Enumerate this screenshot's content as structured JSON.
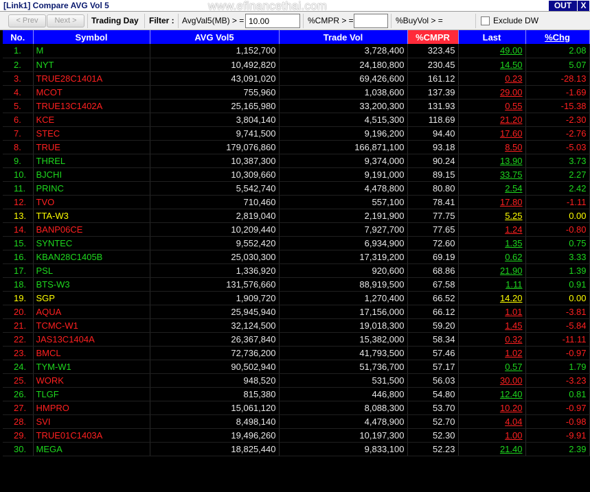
{
  "window": {
    "title": "[Link1] Compare AVG Vol 5",
    "watermark": "www.efinancethai.com",
    "out_label": "OUT",
    "close_label": "X"
  },
  "toolbar": {
    "prev_label": "< Prev",
    "next_label": "Next >",
    "trading_day_label": "Trading Day",
    "filter_label": "Filter :",
    "avgvol_label": "AvgVal5(MB) > =",
    "avgvol_value": "10.00",
    "cmpr_label": "%CMPR > =",
    "cmpr_value": "",
    "buyvol_label": "%BuyVol > =",
    "exclude_label": "Exclude DW"
  },
  "columns": [
    "No.",
    "Symbol",
    "AVG Vol5",
    "Trade Vol",
    "%CMPR",
    "Last",
    "%Chg"
  ],
  "colors": {
    "up": "#1ed81e",
    "down": "#ff2020",
    "unchanged": "#ffff00",
    "header": "#0000ff",
    "highlight_header": "#ff2a3a"
  },
  "rows": [
    {
      "no": "1.",
      "symbol": "M",
      "avg": "1,152,700",
      "trade": "3,728,400",
      "cmpr": "323.45",
      "last": "49.00",
      "chg": "2.08",
      "dir": "up"
    },
    {
      "no": "2.",
      "symbol": "NYT",
      "avg": "10,492,820",
      "trade": "24,180,800",
      "cmpr": "230.45",
      "last": "14.50",
      "chg": "5.07",
      "dir": "up"
    },
    {
      "no": "3.",
      "symbol": "TRUE28C1401A",
      "avg": "43,091,020",
      "trade": "69,426,600",
      "cmpr": "161.12",
      "last": "0.23",
      "chg": "-28.13",
      "dir": "down"
    },
    {
      "no": "4.",
      "symbol": "MCOT",
      "avg": "755,960",
      "trade": "1,038,600",
      "cmpr": "137.39",
      "last": "29.00",
      "chg": "-1.69",
      "dir": "down"
    },
    {
      "no": "5.",
      "symbol": "TRUE13C1402A",
      "avg": "25,165,980",
      "trade": "33,200,300",
      "cmpr": "131.93",
      "last": "0.55",
      "chg": "-15.38",
      "dir": "down"
    },
    {
      "no": "6.",
      "symbol": "KCE",
      "avg": "3,804,140",
      "trade": "4,515,300",
      "cmpr": "118.69",
      "last": "21.20",
      "chg": "-2.30",
      "dir": "down"
    },
    {
      "no": "7.",
      "symbol": "STEC",
      "avg": "9,741,500",
      "trade": "9,196,200",
      "cmpr": "94.40",
      "last": "17.60",
      "chg": "-2.76",
      "dir": "down"
    },
    {
      "no": "8.",
      "symbol": "TRUE",
      "avg": "179,076,860",
      "trade": "166,871,100",
      "cmpr": "93.18",
      "last": "8.50",
      "chg": "-5.03",
      "dir": "down"
    },
    {
      "no": "9.",
      "symbol": "THREL",
      "avg": "10,387,300",
      "trade": "9,374,000",
      "cmpr": "90.24",
      "last": "13.90",
      "chg": "3.73",
      "dir": "up"
    },
    {
      "no": "10.",
      "symbol": "BJCHI",
      "avg": "10,309,660",
      "trade": "9,191,000",
      "cmpr": "89.15",
      "last": "33.75",
      "chg": "2.27",
      "dir": "up"
    },
    {
      "no": "11.",
      "symbol": "PRINC",
      "avg": "5,542,740",
      "trade": "4,478,800",
      "cmpr": "80.80",
      "last": "2.54",
      "chg": "2.42",
      "dir": "up"
    },
    {
      "no": "12.",
      "symbol": "TVO",
      "avg": "710,460",
      "trade": "557,100",
      "cmpr": "78.41",
      "last": "17.80",
      "chg": "-1.11",
      "dir": "down"
    },
    {
      "no": "13.",
      "symbol": "TTA-W3",
      "avg": "2,819,040",
      "trade": "2,191,900",
      "cmpr": "77.75",
      "last": "5.25",
      "chg": "0.00",
      "dir": "eq"
    },
    {
      "no": "14.",
      "symbol": "BANP06CE",
      "avg": "10,209,440",
      "trade": "7,927,700",
      "cmpr": "77.65",
      "last": "1.24",
      "chg": "-0.80",
      "dir": "down"
    },
    {
      "no": "15.",
      "symbol": "SYNTEC",
      "avg": "9,552,420",
      "trade": "6,934,900",
      "cmpr": "72.60",
      "last": "1.35",
      "chg": "0.75",
      "dir": "up"
    },
    {
      "no": "16.",
      "symbol": "KBAN28C1405B",
      "avg": "25,030,300",
      "trade": "17,319,200",
      "cmpr": "69.19",
      "last": "0.62",
      "chg": "3.33",
      "dir": "up"
    },
    {
      "no": "17.",
      "symbol": "PSL",
      "avg": "1,336,920",
      "trade": "920,600",
      "cmpr": "68.86",
      "last": "21.90",
      "chg": "1.39",
      "dir": "up"
    },
    {
      "no": "18.",
      "symbol": "BTS-W3",
      "avg": "131,576,660",
      "trade": "88,919,500",
      "cmpr": "67.58",
      "last": "1.11",
      "chg": "0.91",
      "dir": "up"
    },
    {
      "no": "19.",
      "symbol": "SGP",
      "avg": "1,909,720",
      "trade": "1,270,400",
      "cmpr": "66.52",
      "last": "14.20",
      "chg": "0.00",
      "dir": "eq"
    },
    {
      "no": "20.",
      "symbol": "AQUA",
      "avg": "25,945,940",
      "trade": "17,156,000",
      "cmpr": "66.12",
      "last": "1.01",
      "chg": "-3.81",
      "dir": "down"
    },
    {
      "no": "21.",
      "symbol": "TCMC-W1",
      "avg": "32,124,500",
      "trade": "19,018,300",
      "cmpr": "59.20",
      "last": "1.45",
      "chg": "-5.84",
      "dir": "down"
    },
    {
      "no": "22.",
      "symbol": "JAS13C1404A",
      "avg": "26,367,840",
      "trade": "15,382,000",
      "cmpr": "58.34",
      "last": "0.32",
      "chg": "-11.11",
      "dir": "down"
    },
    {
      "no": "23.",
      "symbol": "BMCL",
      "avg": "72,736,200",
      "trade": "41,793,500",
      "cmpr": "57.46",
      "last": "1.02",
      "chg": "-0.97",
      "dir": "down"
    },
    {
      "no": "24.",
      "symbol": "TYM-W1",
      "avg": "90,502,940",
      "trade": "51,736,700",
      "cmpr": "57.17",
      "last": "0.57",
      "chg": "1.79",
      "dir": "up"
    },
    {
      "no": "25.",
      "symbol": "WORK",
      "avg": "948,520",
      "trade": "531,500",
      "cmpr": "56.03",
      "last": "30.00",
      "chg": "-3.23",
      "dir": "down"
    },
    {
      "no": "26.",
      "symbol": "TLGF",
      "avg": "815,380",
      "trade": "446,800",
      "cmpr": "54.80",
      "last": "12.40",
      "chg": "0.81",
      "dir": "up"
    },
    {
      "no": "27.",
      "symbol": "HMPRO",
      "avg": "15,061,120",
      "trade": "8,088,300",
      "cmpr": "53.70",
      "last": "10.20",
      "chg": "-0.97",
      "dir": "down"
    },
    {
      "no": "28.",
      "symbol": "SVI",
      "avg": "8,498,140",
      "trade": "4,478,900",
      "cmpr": "52.70",
      "last": "4.04",
      "chg": "-0.98",
      "dir": "down"
    },
    {
      "no": "29.",
      "symbol": "TRUE01C1403A",
      "avg": "19,496,260",
      "trade": "10,197,300",
      "cmpr": "52.30",
      "last": "1.00",
      "chg": "-9.91",
      "dir": "down"
    },
    {
      "no": "30.",
      "symbol": "MEGA",
      "avg": "18,825,440",
      "trade": "9,833,100",
      "cmpr": "52.23",
      "last": "21.40",
      "chg": "2.39",
      "dir": "up"
    }
  ]
}
